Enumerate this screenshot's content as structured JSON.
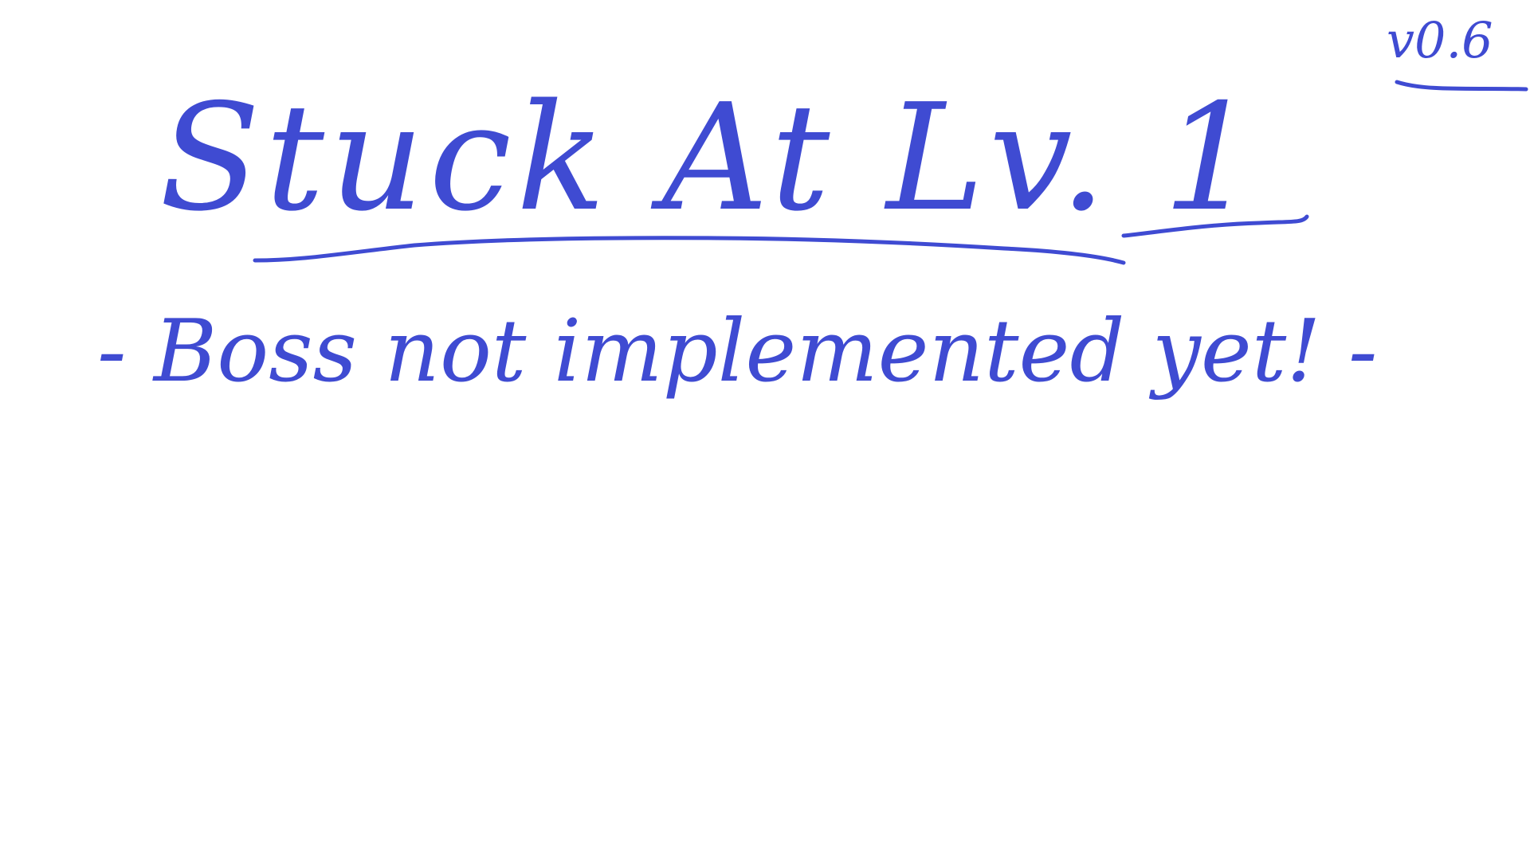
{
  "screen": {
    "title": "Stuck At Lv. 1",
    "version": "v0.6",
    "message": "- Boss not implemented yet! -"
  },
  "colors": {
    "ink": "#3F4BD2",
    "background": "#FFFFFF"
  }
}
